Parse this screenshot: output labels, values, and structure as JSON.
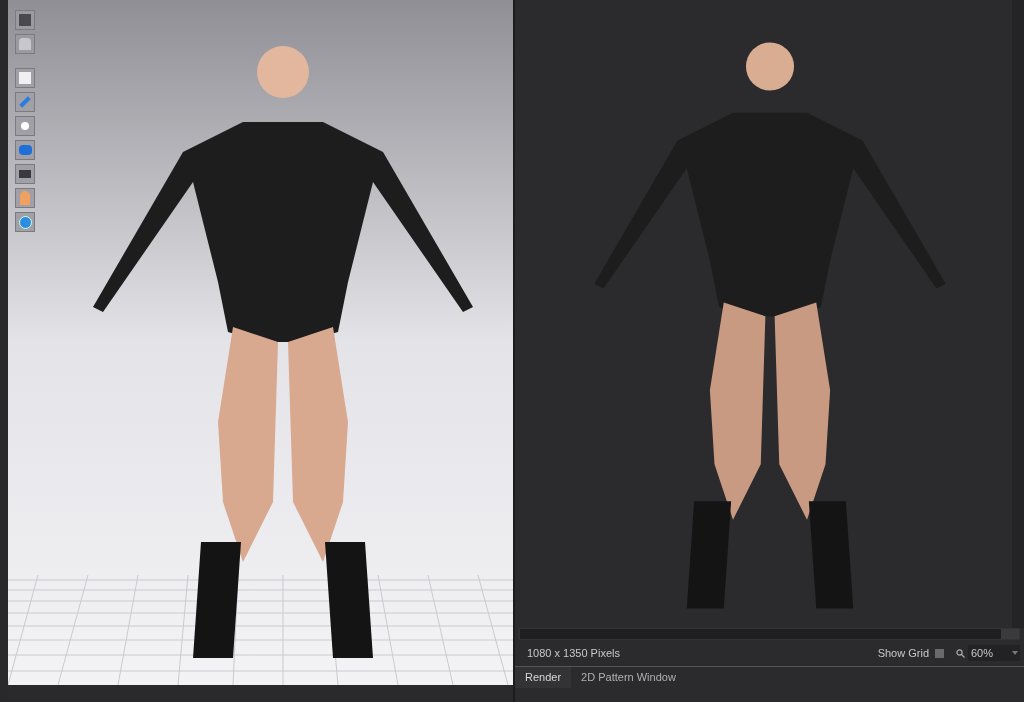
{
  "render_view": {
    "resolution": "1080 x 1350 Pixels",
    "show_grid": {
      "label": "Show Grid",
      "checked": false
    },
    "zoom": {
      "value": "60%"
    }
  },
  "tabs": [
    {
      "label": "Render",
      "selected": true
    },
    {
      "label": "2D Pattern Window",
      "selected": false
    }
  ]
}
